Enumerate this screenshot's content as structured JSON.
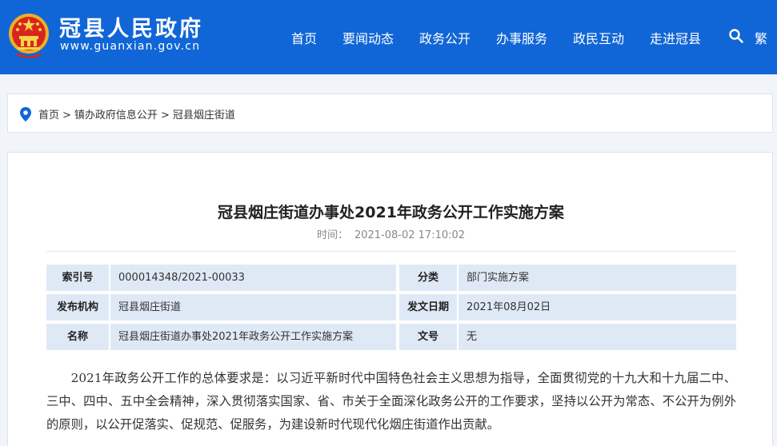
{
  "header": {
    "site_title": "冠县人民政府",
    "site_url": "www.guanxian.gov.cn",
    "nav": [
      "首页",
      "要闻动态",
      "政务公开",
      "办事服务",
      "政民互动",
      "走进冠县"
    ],
    "traditional_toggle": "繁",
    "icons": {
      "emblem": "national-emblem-icon",
      "search": "search-icon"
    },
    "colors": {
      "header_bg": "#1066d6"
    }
  },
  "breadcrumb": {
    "icon": "location-pin-icon",
    "items": [
      "首页",
      "镇办政府信息公开",
      "冠县烟庄街道"
    ],
    "separator": ">"
  },
  "article": {
    "title": "冠县烟庄街道办事处2021年政务公开工作实施方案",
    "time_label": "时间：",
    "time_value": "2021-08-02 17:10:02",
    "meta": [
      {
        "label": "索引号",
        "value": "000014348/2021-00033",
        "label2": "分类",
        "value2": "部门实施方案"
      },
      {
        "label": "发布机构",
        "value": "冠县烟庄街道",
        "label2": "发文日期",
        "value2": "2021年08月02日"
      },
      {
        "label": "名称",
        "value": "冠县烟庄街道办事处2021年政务公开工作实施方案",
        "label2": "文号",
        "value2": "无"
      }
    ],
    "body": "2021年政务公开工作的总体要求是：以习近平新时代中国特色社会主义思想为指导，全面贯彻党的十九大和十九届二中、三中、四中、五中全会精神，深入贯彻落实国家、省、市关于全面深化政务公开的工作要求，坚持以公开为常态、不公开为例外的原则，以公开促落实、促规范、促服务，为建设新时代现代化烟庄街道作出贡献。"
  }
}
